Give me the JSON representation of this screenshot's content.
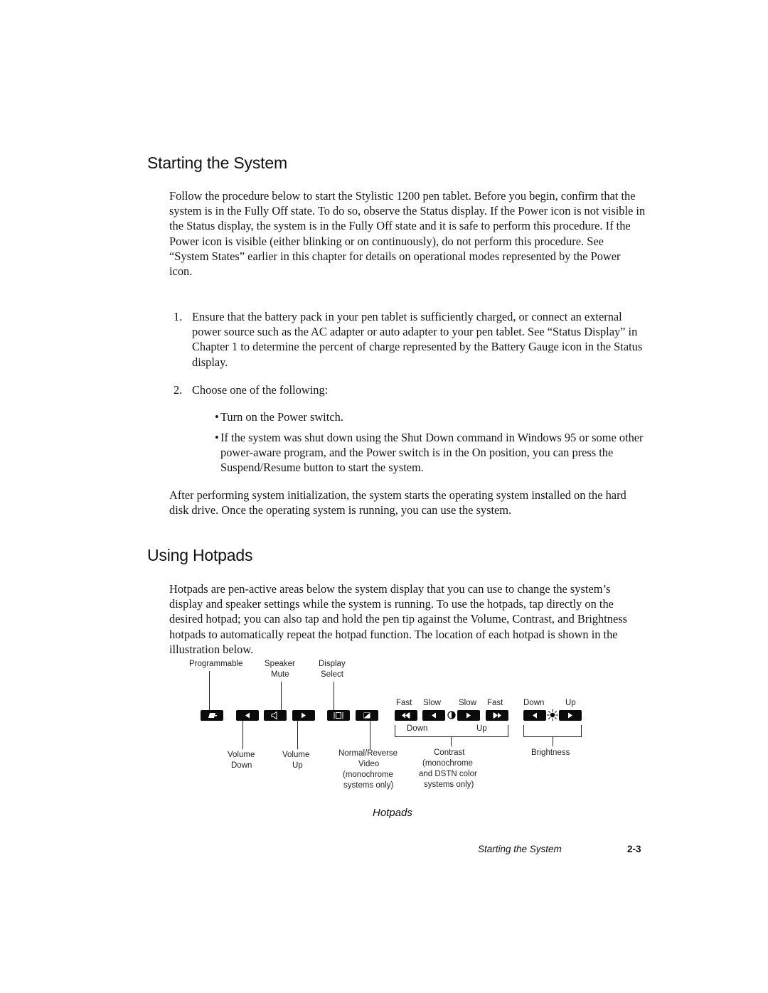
{
  "sections": [
    {
      "heading": "Starting the System",
      "intro": "Follow the procedure below to start the Stylistic 1200 pen tablet. Before you begin, confirm that the system is in the Fully Off state. To do so, observe the Status display. If the Power icon is not visible in the Status display, the system is in the Fully Off state and it is safe to perform this procedure. If the Power icon is visible (either blinking or on continuously), do not perform this procedure. See “System States” earlier in this chapter for details on operational modes represented by the Power icon.",
      "steps": [
        {
          "number": "1.",
          "text": "Ensure that the battery pack in your pen tablet is sufficiently charged, or connect an external power source such as the AC adapter or auto adapter to your pen tablet. See “Status Display” in Chapter 1 to determine the percent of charge represented by the Battery Gauge icon in the Status display."
        },
        {
          "number": "2.",
          "text": "Choose one of the following:",
          "bullets": [
            "Turn on the Power switch.",
            "If the system was shut down using the Shut Down command in Windows 95 or some other power-aware program, and the Power switch is in the On position, you can press the Suspend/Resume button to start the system."
          ]
        }
      ],
      "outro": "After performing system initialization, the system starts the operating system installed on the hard disk drive. Once the operating system is running, you can use the system."
    },
    {
      "heading": "Using Hotpads",
      "intro": "Hotpads are pen-active areas below the system display that you can use to change the system’s display and speaker settings while the system is running. To use the hotpads, tap directly on the desired hotpad; you can also tap and hold the pen tip against the Volume, Contrast, and Brightness hotpads to automatically repeat the hotpad function. The location of each hotpad is shown in the illustration below."
    }
  ],
  "bullet_char": "•",
  "diagram": {
    "top_labels": {
      "programmable": "Programmable",
      "speaker_mute": [
        "Speaker",
        "Mute"
      ],
      "display_select": [
        "Display",
        "Select"
      ]
    },
    "contrast_speed_labels": [
      "Fast",
      "Slow",
      "Slow",
      "Fast"
    ],
    "contrast_dir_labels": [
      "Down",
      "Up"
    ],
    "brightness_dir_labels": [
      "Down",
      "Up"
    ],
    "bottom_labels": {
      "volume_down": [
        "Volume",
        "Down"
      ],
      "volume_up": [
        "Volume",
        "Up"
      ],
      "normal_reverse": [
        "Normal/Reverse",
        "Video",
        "(monochrome",
        "systems only)"
      ],
      "contrast": [
        "Contrast",
        "(monochrome",
        "and DSTN color",
        "systems only)"
      ],
      "brightness": [
        "Brightness"
      ]
    },
    "hotpads": [
      {
        "name": "programmable",
        "icon": "pen-icon"
      },
      {
        "name": "volume-down",
        "icon": "left-arrow-icon"
      },
      {
        "name": "speaker-mute",
        "icon": "speaker-icon"
      },
      {
        "name": "volume-up",
        "icon": "right-arrow-icon"
      },
      {
        "name": "display-select",
        "icon": "display-icon"
      },
      {
        "name": "normal-reverse-video",
        "icon": "reverse-video-icon"
      },
      {
        "name": "contrast-down-fast",
        "icon": "double-left-arrow-icon"
      },
      {
        "name": "contrast-down-slow",
        "icon": "left-arrow-icon"
      },
      {
        "name": "contrast-up-slow",
        "icon": "right-arrow-icon"
      },
      {
        "name": "contrast-up-fast",
        "icon": "double-right-arrow-icon"
      },
      {
        "name": "brightness-down",
        "icon": "left-arrow-icon"
      },
      {
        "name": "brightness-up",
        "icon": "right-arrow-icon"
      }
    ],
    "caption": "Hotpads"
  },
  "footer": {
    "section_title": "Starting the System",
    "page_number": "2-3"
  }
}
